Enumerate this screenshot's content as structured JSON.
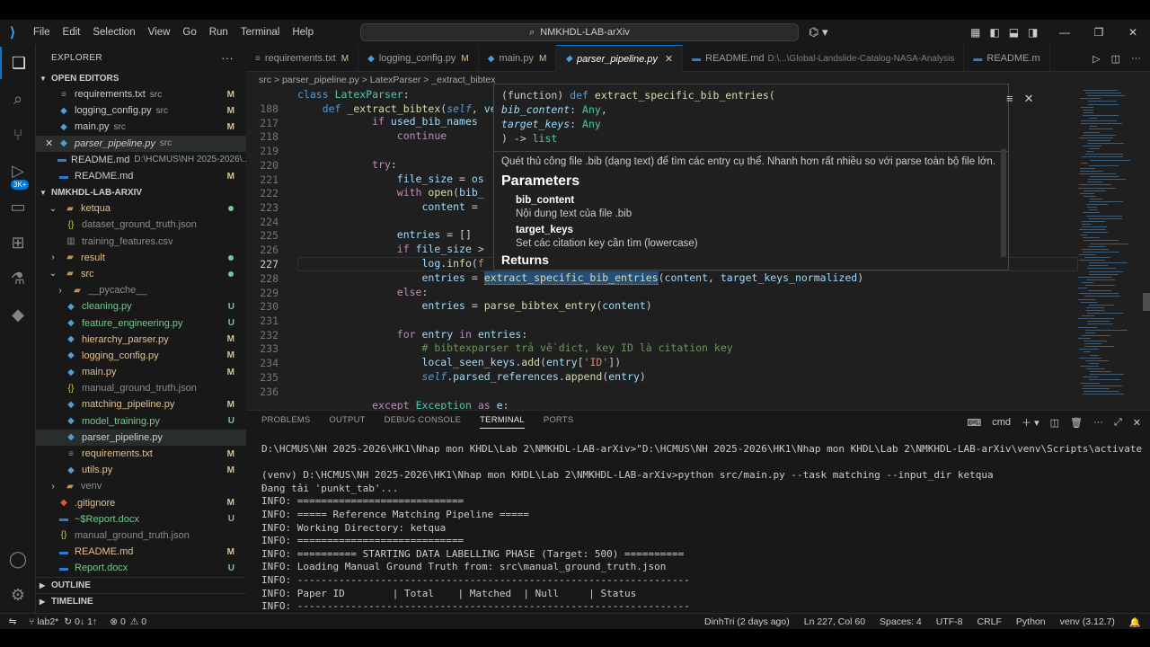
{
  "app": {
    "menu": [
      "File",
      "Edit",
      "Selection",
      "View",
      "Go",
      "Run",
      "Terminal",
      "Help"
    ],
    "search_text": "NMKHDL-LAB-arXiv"
  },
  "explorer": {
    "title": "EXPLORER",
    "open_editors_label": "OPEN EDITORS",
    "open_editors": [
      {
        "name": "requirements.txt",
        "desc": "src",
        "status": "M",
        "icon": "txt"
      },
      {
        "name": "logging_config.py",
        "desc": "src",
        "status": "M",
        "icon": "py"
      },
      {
        "name": "main.py",
        "desc": "src",
        "status": "M",
        "icon": "py"
      },
      {
        "name": "parser_pipeline.py",
        "desc": "src",
        "status": "",
        "icon": "py"
      },
      {
        "name": "README.md",
        "desc": "D:\\HCMUS\\NH 2025-2026\\...",
        "status": "",
        "icon": "md"
      },
      {
        "name": "README.md",
        "desc": "",
        "status": "M",
        "icon": "md"
      }
    ],
    "project_label": "NMKHDL-LAB-ARXIV",
    "tree": [
      {
        "name": "ketqua",
        "status": "dot",
        "type": "folder",
        "open": true
      },
      {
        "name": "dataset_ground_truth.json",
        "status": "",
        "type": "json"
      },
      {
        "name": "training_features.csv",
        "status": "",
        "type": "csv"
      },
      {
        "name": "result",
        "status": "dot",
        "type": "folder",
        "open": false
      },
      {
        "name": "src",
        "status": "dot",
        "type": "folder",
        "open": true
      },
      {
        "name": "__pycache__",
        "status": "",
        "type": "folder",
        "open": false
      },
      {
        "name": "cleaning.py",
        "status": "U",
        "type": "py"
      },
      {
        "name": "feature_engineering.py",
        "status": "U",
        "type": "py"
      },
      {
        "name": "hierarchy_parser.py",
        "status": "M",
        "type": "py"
      },
      {
        "name": "logging_config.py",
        "status": "M",
        "type": "py"
      },
      {
        "name": "main.py",
        "status": "M",
        "type": "py"
      },
      {
        "name": "manual_ground_truth.json",
        "status": "",
        "type": "json"
      },
      {
        "name": "matching_pipeline.py",
        "status": "M",
        "type": "py"
      },
      {
        "name": "model_training.py",
        "status": "U",
        "type": "py"
      },
      {
        "name": "parser_pipeline.py",
        "status": "",
        "type": "py"
      },
      {
        "name": "requirements.txt",
        "status": "M",
        "type": "txt"
      },
      {
        "name": "utils.py",
        "status": "M",
        "type": "py"
      },
      {
        "name": "venv",
        "status": "",
        "type": "folder",
        "open": false
      },
      {
        "name": ".gitignore",
        "status": "M",
        "type": "git"
      },
      {
        "name": "~$Report.docx",
        "status": "U",
        "type": "doc"
      },
      {
        "name": "manual_ground_truth.json",
        "status": "",
        "type": "json"
      },
      {
        "name": "README.md",
        "status": "M",
        "type": "md"
      },
      {
        "name": "Report.docx",
        "status": "U",
        "type": "doc"
      }
    ],
    "outline_label": "OUTLINE",
    "timeline_label": "TIMELINE"
  },
  "tabs": [
    {
      "name": "requirements.txt",
      "status": "M",
      "path": ""
    },
    {
      "name": "logging_config.py",
      "status": "M",
      "path": ""
    },
    {
      "name": "main.py",
      "status": "M",
      "path": ""
    },
    {
      "name": "parser_pipeline.py",
      "status": "",
      "path": ""
    },
    {
      "name": "README.md",
      "status": "",
      "path": "D:\\...\\Global-Landslide-Catalog-NASA-Analysis"
    },
    {
      "name": "README.m",
      "status": "",
      "path": ""
    }
  ],
  "breadcrumb": "src  >  parser_pipeline.py  >  LatexParser  >  _extract_bibtex",
  "editor": {
    "sticky1": "class LatexParser:",
    "sticky2_ln": "188",
    "lines": [
      {
        "ln": "217"
      },
      {
        "ln": "218"
      },
      {
        "ln": "219"
      },
      {
        "ln": "220"
      },
      {
        "ln": "221"
      },
      {
        "ln": "222"
      },
      {
        "ln": "223"
      },
      {
        "ln": "224"
      },
      {
        "ln": "225"
      },
      {
        "ln": "226"
      },
      {
        "ln": "227"
      },
      {
        "ln": "228"
      },
      {
        "ln": "229"
      },
      {
        "ln": "230"
      },
      {
        "ln": "231"
      },
      {
        "ln": "232"
      },
      {
        "ln": "233"
      },
      {
        "ln": "234"
      },
      {
        "ln": "235"
      },
      {
        "ln": "236"
      }
    ]
  },
  "hover": {
    "sig_fn": "extract_specific_bib_entries",
    "param1": "bib_content",
    "param2": "target_keys",
    "ret": "list",
    "description": "Quét thủ công file .bib (dạng text) để tìm các entry cụ thể. Nhanh hơn rất nhiều so với parse toàn bộ file lớn.",
    "params_title": "Parameters",
    "p1_name": "bib_content",
    "p1_desc": "Nội dung text của file .bib",
    "p2_name": "target_keys",
    "p2_desc": "Set các citation key cần tìm (lowercase)",
    "returns_title": "Returns"
  },
  "panel": {
    "tabs": [
      "PROBLEMS",
      "OUTPUT",
      "DEBUG CONSOLE",
      "TERMINAL",
      "PORTS"
    ],
    "active_tab": "TERMINAL",
    "shell": "cmd",
    "lines": [
      "D:\\HCMUS\\NH 2025-2026\\HK1\\Nhap mon KHDL\\Lab 2\\NMKHDL-LAB-arXiv>\"D:\\HCMUS\\NH 2025-2026\\HK1\\Nhap mon KHDL\\Lab 2\\NMKHDL-LAB-arXiv\\venv\\Scripts\\activate.bat\"",
      "",
      "(venv) D:\\HCMUS\\NH 2025-2026\\HK1\\Nhap mon KHDL\\Lab 2\\NMKHDL-LAB-arXiv>python src/main.py --task matching --input_dir ketqua",
      "Đang tải 'punkt_tab'...",
      "INFO: ============================",
      "INFO: ===== Reference Matching Pipeline =====",
      "INFO: Working Directory: ketqua",
      "INFO: ============================",
      "INFO: ========== STARTING DATA LABELLING PHASE (Target: 500) ==========",
      "INFO: Loading Manual Ground Truth from: src\\manual_ground_truth.json",
      "INFO: ------------------------------------------------------------------",
      "INFO: Paper ID        | Total    | Matched  | Null     | Status",
      "INFO: ------------------------------------------------------------------"
    ]
  },
  "status": {
    "branch": "lab2*",
    "sync": "0↓ 1↑",
    "errors": "0",
    "warnings": "0",
    "blame": "DinhTri (2 days ago)",
    "position": "Ln 227, Col 60",
    "spaces": "Spaces: 4",
    "encoding": "UTF-8",
    "eol": "CRLF",
    "language": "Python",
    "interpreter": "venv (3.12.7)"
  },
  "colors": {
    "accent": "#0078d4",
    "modified": "#e2c08d",
    "untracked": "#73c991"
  }
}
